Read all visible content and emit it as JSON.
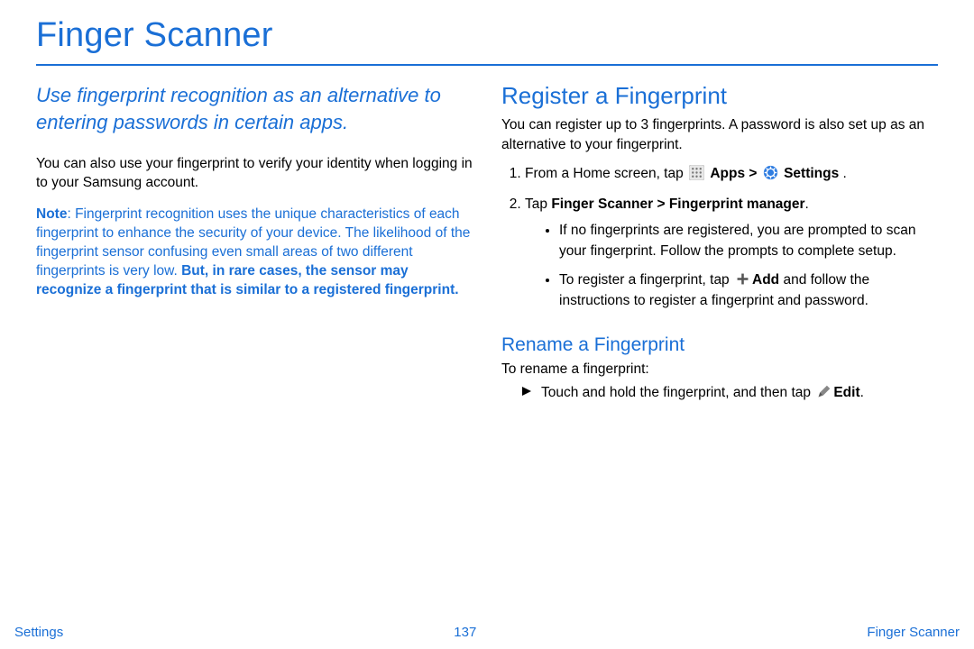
{
  "page": {
    "title": "Finger Scanner",
    "footer_left": "Settings",
    "footer_center": "137",
    "footer_right": "Finger Scanner"
  },
  "left": {
    "intro": "Use fingerprint recognition as an alternative to entering passwords in certain apps.",
    "body": "You can also use your fingerprint to verify your identity when logging in to your Samsung account.",
    "note_label": "Note",
    "note_body": ": Fingerprint recognition uses the unique characteristics of each fingerprint to enhance the security of your device. The likelihood of the fingerprint sensor confusing even small areas of two different fingerprints is very low. ",
    "note_warn": "But, in rare cases, the sensor may recognize a fingerprint that is similar to a registered fingerprint."
  },
  "right": {
    "h2": "Register a Fingerprint",
    "reg_intro": "You can register up to 3 fingerprints. A password is also set up as an alternative to your fingerprint.",
    "step1_a": "From a Home screen, tap ",
    "step1_apps": "Apps > ",
    "step1_settings": "Settings",
    "step1_end": " .",
    "step2_a": "Tap ",
    "step2_b": "Finger Scanner > Fingerprint manager",
    "step2_c": ".",
    "bullet1": "If no fingerprints are registered, you are prompted to scan your fingerprint. Follow the prompts to complete setup.",
    "bullet2_a": "To register a fingerprint, tap ",
    "bullet2_add": "Add",
    "bullet2_b": " and follow the instructions to register a fingerprint and password.",
    "h3": "Rename a Fingerprint",
    "rename_intro": "To rename a fingerprint:",
    "rename_step_a": "Touch and hold the fingerprint, and then tap ",
    "rename_step_edit": "Edit",
    "rename_step_b": "."
  }
}
